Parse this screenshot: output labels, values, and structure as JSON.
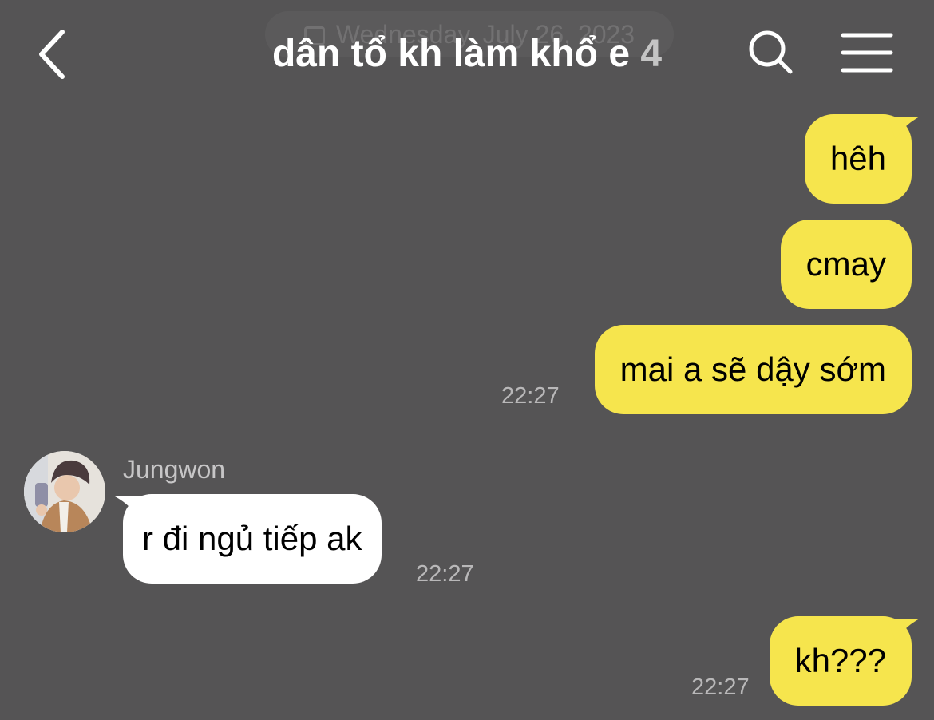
{
  "header": {
    "date_label": "Wednesday, July 26, 2023",
    "title": "dân tổ kh làm khổ e",
    "member_count": "4",
    "icons": [
      "chevron-left-icon",
      "search-icon",
      "hamburger-menu-icon"
    ]
  },
  "messages": [
    {
      "sender": "me",
      "text": "hêh",
      "time": ""
    },
    {
      "sender": "me",
      "text": "cmay",
      "time": ""
    },
    {
      "sender": "me",
      "text": "mai a sẽ dậy sớm",
      "time": "22:27"
    },
    {
      "sender": "Jungwon",
      "text": "r đi ngủ tiếp ak",
      "time": "22:27"
    },
    {
      "sender": "me",
      "text": "kh???",
      "time": "22:27"
    }
  ],
  "colors": {
    "background": "#555455",
    "my_bubble": "#f6e54d",
    "their_bubble": "#ffffff",
    "timestamp": "#b9b8b9",
    "title": "#ffffff",
    "count": "#c4c4c4"
  }
}
